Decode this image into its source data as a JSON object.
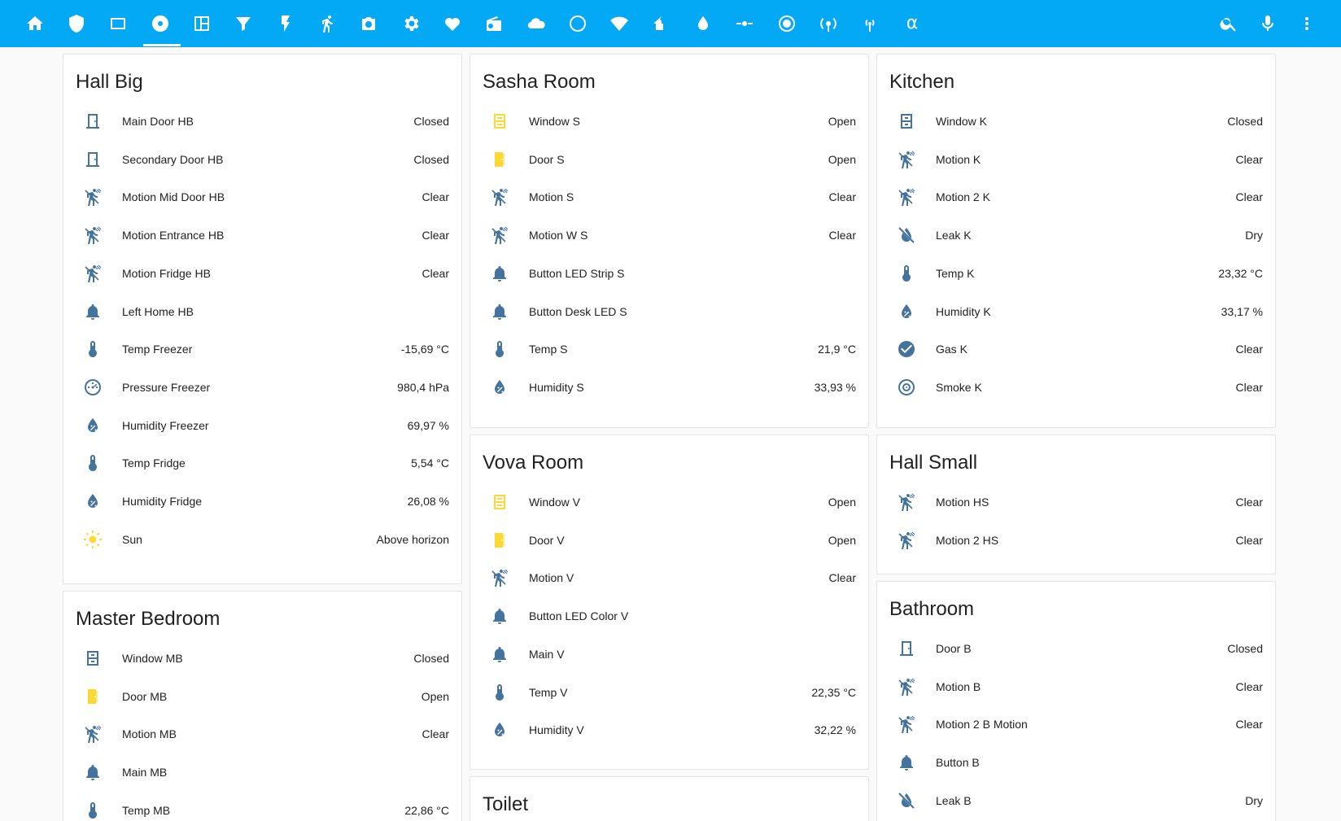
{
  "colors": {
    "toolbar": "#03a9f4",
    "icon_default": "#44739e",
    "icon_active": "#fdd835"
  },
  "toolbar": {
    "left_icons": [
      "home-icon",
      "shield-icon",
      "tablet-icon",
      "disc-icon",
      "dashboard-icon",
      "filter-icon",
      "flash-icon",
      "motion-icon",
      "camera-icon",
      "gear-icon",
      "heart-pulse-icon",
      "radio-icon",
      "cloud-icon",
      "esp-icon",
      "wifi-alert-icon",
      "home-thermometer-icon",
      "water-icon",
      "valve-icon",
      "record-icon",
      "antenna-icon",
      "access-point-icon",
      "alpha-icon"
    ],
    "right_icons": [
      "search-icon",
      "microphone-icon",
      "more-icon"
    ]
  },
  "cards": [
    {
      "title": "Hall Big",
      "rows": [
        {
          "icon": "door",
          "active": false,
          "name": "Main Door HB",
          "value": "Closed"
        },
        {
          "icon": "door",
          "active": false,
          "name": "Secondary Door HB",
          "value": "Closed"
        },
        {
          "icon": "motion",
          "active": false,
          "name": "Motion Mid Door HB",
          "value": "Clear"
        },
        {
          "icon": "motion",
          "active": false,
          "name": "Motion Entrance HB",
          "value": "Clear"
        },
        {
          "icon": "motion",
          "active": false,
          "name": "Motion Fridge HB",
          "value": "Clear"
        },
        {
          "icon": "bell",
          "active": false,
          "name": "Left Home HB",
          "value": ""
        },
        {
          "icon": "thermometer",
          "active": false,
          "name": "Temp Freezer",
          "value": "-15,69 °C"
        },
        {
          "icon": "gauge",
          "active": false,
          "name": "Pressure Freezer",
          "value": "980,4 hPa"
        },
        {
          "icon": "humidity",
          "active": false,
          "name": "Humidity Freezer",
          "value": "69,97 %"
        },
        {
          "icon": "thermometer",
          "active": false,
          "name": "Temp Fridge",
          "value": "5,54 °C"
        },
        {
          "icon": "humidity",
          "active": false,
          "name": "Humidity Fridge",
          "value": "26,08 %"
        },
        {
          "icon": "sun",
          "active": true,
          "name": "Sun",
          "value": "Above horizon"
        }
      ]
    },
    {
      "title": "Master Bedroom",
      "rows": [
        {
          "icon": "window",
          "active": false,
          "name": "Window MB",
          "value": "Closed"
        },
        {
          "icon": "door-open",
          "active": true,
          "name": "Door MB",
          "value": "Open"
        },
        {
          "icon": "motion",
          "active": false,
          "name": "Motion MB",
          "value": "Clear"
        },
        {
          "icon": "bell",
          "active": false,
          "name": "Main MB",
          "value": ""
        },
        {
          "icon": "thermometer",
          "active": false,
          "name": "Temp MB",
          "value": "22,86 °C"
        }
      ]
    },
    {
      "title": "Sasha Room",
      "rows": [
        {
          "icon": "window-open",
          "active": true,
          "name": "Window S",
          "value": "Open"
        },
        {
          "icon": "door-open",
          "active": true,
          "name": "Door S",
          "value": "Open"
        },
        {
          "icon": "motion",
          "active": false,
          "name": "Motion S",
          "value": "Clear"
        },
        {
          "icon": "motion",
          "active": false,
          "name": "Motion W S",
          "value": "Clear"
        },
        {
          "icon": "bell",
          "active": false,
          "name": "Button LED Strip S",
          "value": ""
        },
        {
          "icon": "bell",
          "active": false,
          "name": "Button Desk LED S",
          "value": ""
        },
        {
          "icon": "thermometer",
          "active": false,
          "name": "Temp S",
          "value": "21,9 °C"
        },
        {
          "icon": "humidity",
          "active": false,
          "name": "Humidity S",
          "value": "33,93 %"
        }
      ]
    },
    {
      "title": "Vova Room",
      "rows": [
        {
          "icon": "window-open",
          "active": true,
          "name": "Window V",
          "value": "Open"
        },
        {
          "icon": "door-open",
          "active": true,
          "name": "Door V",
          "value": "Open"
        },
        {
          "icon": "motion",
          "active": false,
          "name": "Motion V",
          "value": "Clear"
        },
        {
          "icon": "bell",
          "active": false,
          "name": "Button LED Color V",
          "value": ""
        },
        {
          "icon": "bell",
          "active": false,
          "name": "Main V",
          "value": ""
        },
        {
          "icon": "thermometer",
          "active": false,
          "name": "Temp V",
          "value": "22,35 °C"
        },
        {
          "icon": "humidity",
          "active": false,
          "name": "Humidity V",
          "value": "32,22 %"
        }
      ]
    },
    {
      "title": "Toilet",
      "rows": []
    },
    {
      "title": "Kitchen",
      "rows": [
        {
          "icon": "window",
          "active": false,
          "name": "Window K",
          "value": "Closed"
        },
        {
          "icon": "motion",
          "active": false,
          "name": "Motion K",
          "value": "Clear"
        },
        {
          "icon": "motion",
          "active": false,
          "name": "Motion 2 K",
          "value": "Clear"
        },
        {
          "icon": "water-off",
          "active": false,
          "name": "Leak K",
          "value": "Dry"
        },
        {
          "icon": "thermometer",
          "active": false,
          "name": "Temp K",
          "value": "23,32 °C"
        },
        {
          "icon": "humidity",
          "active": false,
          "name": "Humidity K",
          "value": "33,17 %"
        },
        {
          "icon": "check-circle",
          "active": false,
          "name": "Gas K",
          "value": "Clear"
        },
        {
          "icon": "smoke",
          "active": false,
          "name": "Smoke K",
          "value": "Clear"
        }
      ]
    },
    {
      "title": "Hall Small",
      "rows": [
        {
          "icon": "motion",
          "active": false,
          "name": "Motion HS",
          "value": "Clear"
        },
        {
          "icon": "motion",
          "active": false,
          "name": "Motion 2 HS",
          "value": "Clear"
        }
      ]
    },
    {
      "title": "Bathroom",
      "rows": [
        {
          "icon": "door",
          "active": false,
          "name": "Door B",
          "value": "Closed"
        },
        {
          "icon": "motion",
          "active": false,
          "name": "Motion B",
          "value": "Clear"
        },
        {
          "icon": "motion",
          "active": false,
          "name": "Motion 2 B Motion",
          "value": "Clear"
        },
        {
          "icon": "bell",
          "active": false,
          "name": "Button B",
          "value": ""
        },
        {
          "icon": "water-off",
          "active": false,
          "name": "Leak B",
          "value": "Dry"
        }
      ]
    }
  ]
}
